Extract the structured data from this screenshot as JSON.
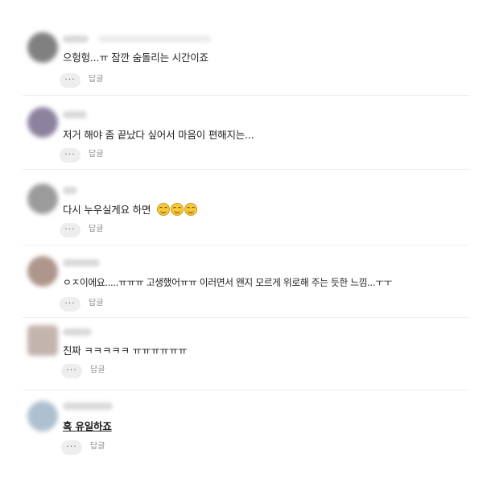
{
  "comments": [
    {
      "text": "으헝헝...ㅠ 잠깐 숨돌리는 시간이죠",
      "more_label": "···",
      "reply_label": "답글",
      "avatar_color": "#6b6b6b"
    },
    {
      "text": "저거 해야 좀 끝났다 싶어서 마음이 편해지는...",
      "more_label": "···",
      "reply_label": "답글",
      "avatar_color": "#7a6d8e"
    },
    {
      "text": "다시 누우실게요 하면",
      "emojis": [
        "smiling-face-emoji",
        "smiling-face-emoji",
        "smiling-face-emoji"
      ],
      "more_label": "···",
      "reply_label": "답글",
      "avatar_color": "#8a8a8a"
    },
    {
      "text": "ㅇㅈ이에요.....ㅠㅠㅠ 고생했어ㅠㅠ 이러면서 왠지 모르게 위로해 주는 듯한 느낌...ㅜㅜ",
      "more_label": "···",
      "reply_label": "답글",
      "avatar_color": "#a08478"
    },
    {
      "text": "진짜 ㅋㅋㅋㅋㅋ ㅠㅠㅠㅠㅠㅠ",
      "more_label": "···",
      "reply_label": "답글",
      "avatar_color": "#b9a7a0"
    },
    {
      "text": "혹 유일하죠",
      "more_label": "···",
      "reply_label": "답글",
      "avatar_color": "#9fb6c9"
    }
  ]
}
